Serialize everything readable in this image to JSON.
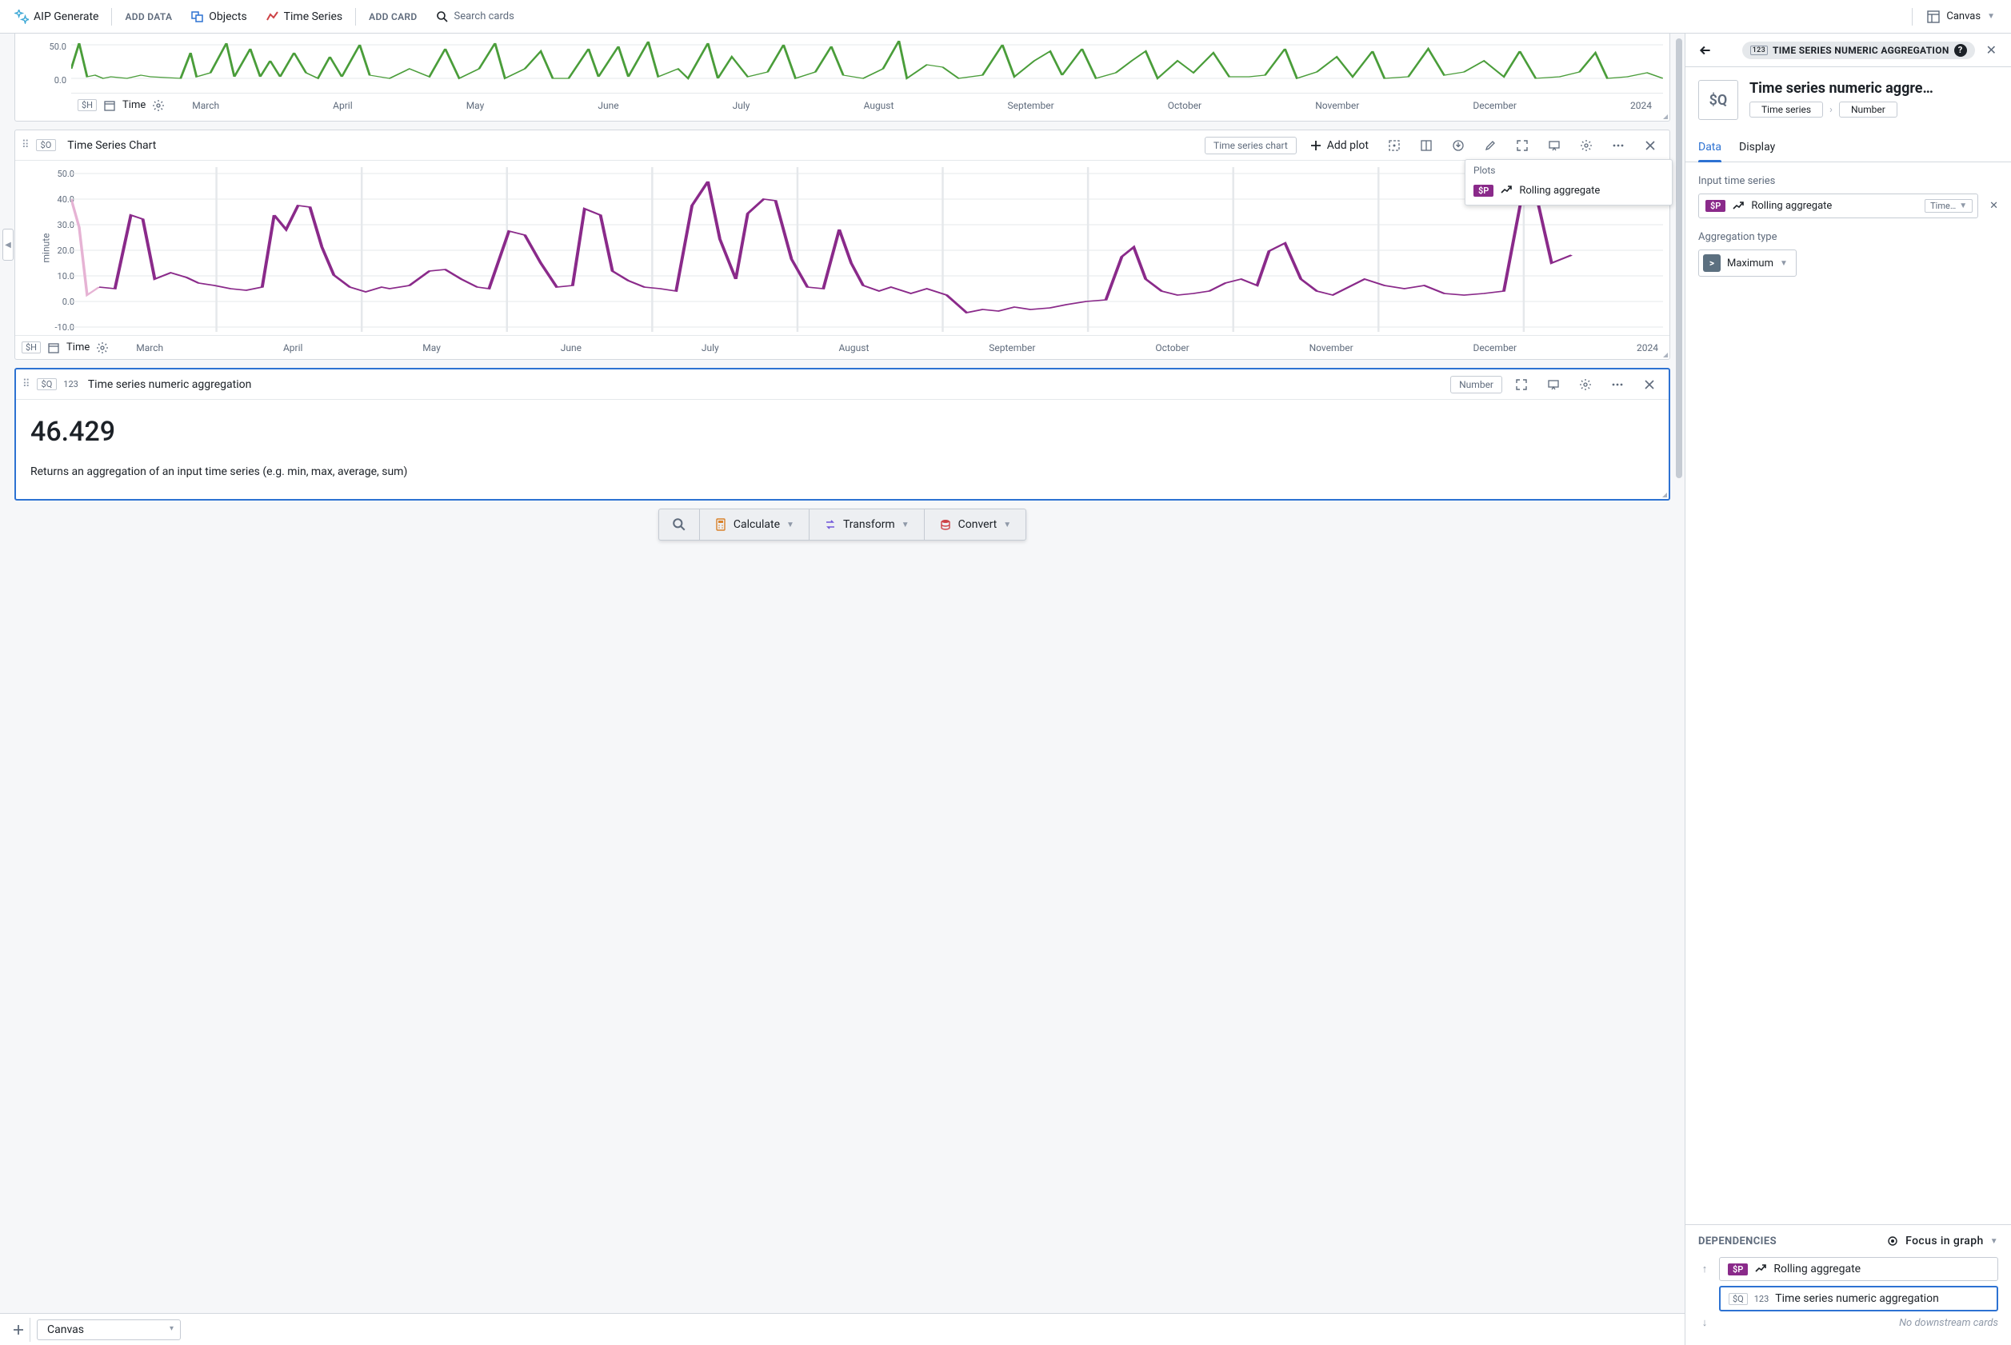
{
  "topbar": {
    "aip_generate": "AIP Generate",
    "add_data": "ADD DATA",
    "objects": "Objects",
    "time_series": "Time Series",
    "add_card": "ADD CARD",
    "search_placeholder": "Search cards",
    "canvas": "Canvas"
  },
  "card_green": {
    "y_ticks": [
      "50.0",
      "0.0"
    ],
    "token": "$H",
    "time_label": "Time",
    "months": [
      "March",
      "April",
      "May",
      "June",
      "July",
      "August",
      "September",
      "October",
      "November",
      "December",
      "2024"
    ]
  },
  "card_chart": {
    "token": "$O",
    "title": "Time Series Chart",
    "badge": "Time series chart",
    "add_plot": "Add plot",
    "y_ticks": [
      "50.0",
      "40.0",
      "30.0",
      "20.0",
      "10.0",
      "0.0",
      "-10.0"
    ],
    "y_label": "minute",
    "plots_header": "Plots",
    "plot_badge": "$P",
    "plot_name": "Rolling aggregate",
    "footer_token": "$H",
    "footer_time": "Time",
    "months": [
      "March",
      "April",
      "May",
      "June",
      "July",
      "August",
      "September",
      "October",
      "November",
      "December",
      "2024"
    ]
  },
  "card_agg": {
    "token": "$Q",
    "type_badge": "123",
    "title": "Time series numeric aggregation",
    "output_type": "Number",
    "value": "46.429",
    "description": "Returns an aggregation of an input time series (e.g. min, max, average, sum)"
  },
  "action_bar": {
    "calculate": "Calculate",
    "transform": "Transform",
    "convert": "Convert"
  },
  "bottom": {
    "tab": "Canvas"
  },
  "right_panel": {
    "pill_num": "123",
    "pill_text": "TIME SERIES NUMERIC AGGREGATION",
    "big_token": "$Q",
    "title": "Time series numeric aggre…",
    "crumb1": "Time series",
    "crumb2": "Number",
    "tabs": {
      "data": "Data",
      "display": "Display"
    },
    "input_label": "Input time series",
    "input_badge": "$P",
    "input_name": "Rolling aggregate",
    "input_type_text": "Time…",
    "agg_label": "Aggregation type",
    "agg_value": "Maximum",
    "deps": {
      "header": "DEPENDENCIES",
      "focus": "Focus in graph",
      "upstream_badge": "$P",
      "upstream_name": "Rolling aggregate",
      "current_token": "$Q",
      "current_num": "123",
      "current_name": "Time series numeric aggregation",
      "no_downstream": "No downstream cards"
    }
  },
  "chart_data": [
    {
      "type": "line",
      "name": "green-mini",
      "note": "partial top chart, values approximate and jittery",
      "y_range": [
        0,
        50
      ],
      "x_categories": [
        "March",
        "April",
        "May",
        "June",
        "July",
        "August",
        "September",
        "October",
        "November",
        "December",
        "2024"
      ]
    },
    {
      "type": "line",
      "name": "rolling-aggregate",
      "ylabel": "minute",
      "y_range": [
        -10,
        50
      ],
      "x_categories": [
        "March",
        "April",
        "May",
        "June",
        "July",
        "August",
        "September",
        "October",
        "November",
        "December",
        "2024"
      ],
      "series": [
        {
          "name": "Rolling aggregate",
          "color": "#8a2a8a",
          "values_approx_by_month": {
            "March": [
              5,
              33,
              10,
              12,
              11,
              8,
              9,
              7,
              6,
              5,
              4
            ],
            "April": [
              5,
              35,
              30,
              37,
              36,
              22,
              10,
              6,
              4,
              5
            ],
            "May": [
              6,
              4,
              8,
              12,
              10,
              6,
              5,
              7,
              30,
              28,
              15,
              6
            ],
            "June": [
              5,
              36,
              32,
              12,
              8,
              6,
              5,
              4
            ],
            "July": [
              5,
              40,
              46,
              25,
              8,
              35,
              40,
              18,
              6,
              4
            ],
            "August": [
              5,
              32,
              15,
              6,
              5,
              4,
              3,
              2,
              -5,
              -4,
              -3
            ],
            "September": [
              -3,
              -2,
              0,
              2,
              4,
              3,
              2
            ],
            "October": [
              3,
              2,
              4,
              18,
              22,
              8,
              4,
              2,
              3,
              8,
              6
            ],
            "November": [
              4,
              3,
              20,
              24,
              10,
              4,
              3,
              8
            ],
            "December": [
              4,
              6,
              5,
              4,
              3,
              2,
              4,
              48,
              44,
              15
            ]
          }
        }
      ]
    }
  ]
}
